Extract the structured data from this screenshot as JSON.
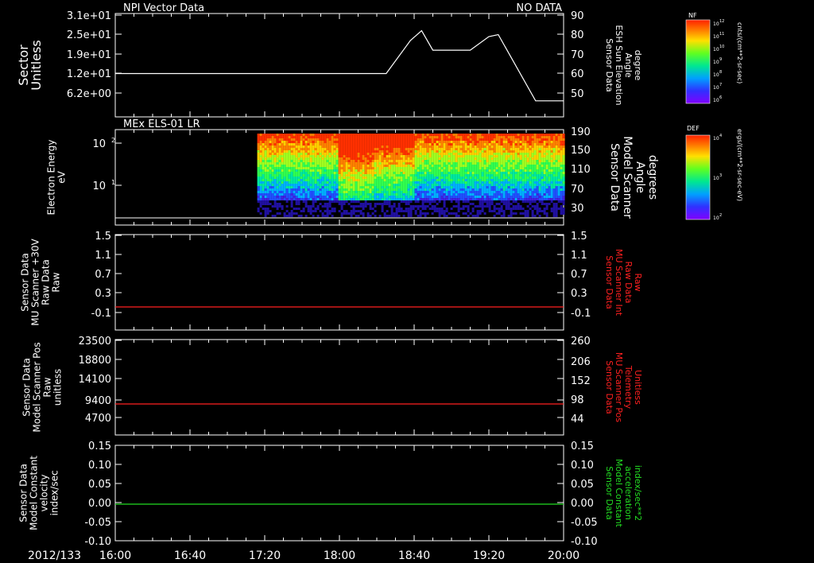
{
  "date_label": "2012/133",
  "time_ticks": [
    "16:00",
    "16:40",
    "17:20",
    "18:00",
    "18:40",
    "19:20",
    "20:00"
  ],
  "panels": [
    {
      "id": "p1",
      "title": "NPI Vector Data",
      "status": "NO DATA",
      "left_label": [
        "Sector",
        "Unitless"
      ],
      "left_ticks": [
        "3.1e+01",
        "2.5e+01",
        "1.9e+01",
        "1.2e+01",
        "6.2e+00"
      ],
      "right_label": [
        "Sensor Data",
        "ESH Sun Elevation",
        "Angle",
        "degree"
      ],
      "right_ticks": [
        "90",
        "80",
        "70",
        "60",
        "50"
      ],
      "right_color": "#ffffff"
    },
    {
      "id": "p2",
      "title": "MEx ELS-01 LR",
      "left_label": [
        "Electron Energy",
        "eV"
      ],
      "left_ticks": [
        "10",
        "10"
      ],
      "left_tick_exps": [
        "2",
        "1"
      ],
      "right_label": [
        "Sensor Data",
        "Model Scanner",
        "Angle",
        "degrees"
      ],
      "right_ticks": [
        "190",
        "150",
        "110",
        "70",
        "30"
      ],
      "right_color": "#ffffff"
    },
    {
      "id": "p3",
      "left_label": [
        "Sensor Data",
        "MU Scanner +30V",
        "Raw Data",
        "Raw"
      ],
      "left_ticks": [
        "1.5",
        "1.1",
        "0.7",
        "0.3",
        "-0.1"
      ],
      "right_label": [
        "Sensor Data",
        "MU Scanner Int",
        "Raw Data",
        "Raw"
      ],
      "right_ticks": [
        "1.5",
        "1.1",
        "0.7",
        "0.3",
        "-0.1"
      ],
      "right_color": "#ff2020"
    },
    {
      "id": "p4",
      "left_label": [
        "Sensor Data",
        "Model Scanner Pos",
        "Raw",
        "unitless"
      ],
      "left_ticks": [
        "23500",
        "18800",
        "14100",
        "9400",
        "4700"
      ],
      "right_label": [
        "Sensor Data",
        "MU Scanner Pos",
        "Telemetry",
        "Unitless"
      ],
      "right_ticks": [
        "260",
        "206",
        "152",
        "98",
        "44"
      ],
      "right_color": "#ff2020"
    },
    {
      "id": "p5",
      "left_label": [
        "Sensor Data",
        "Model Constant",
        "velocity",
        "index/sec"
      ],
      "left_ticks": [
        "0.15",
        "0.10",
        "0.05",
        "0.00",
        "-0.05",
        "-0.10"
      ],
      "right_label": [
        "Sensor Data",
        "Model Constant",
        "acceleration",
        "index/sec**2"
      ],
      "right_ticks": [
        "0.15",
        "0.10",
        "0.05",
        "0.00",
        "-0.05",
        "-0.10"
      ],
      "right_color": "#22dd22"
    }
  ],
  "colorbars": [
    {
      "title": "NF",
      "units": "cnts/(cm**2-sr-sec)",
      "ticks_base": "10",
      "ticks_exp": [
        "12",
        "11",
        "10",
        "9",
        "8",
        "7",
        "6"
      ]
    },
    {
      "title": "DEF",
      "units": "ergs/(cm**2-sr-sec-eV)",
      "ticks_base": "10",
      "ticks_exp": [
        "4",
        "3",
        "2"
      ]
    }
  ],
  "colors": {
    "axis": "#ffffff",
    "red_line": "#ff2020",
    "green_line": "#22dd22"
  },
  "chart_data": [
    {
      "type": "line",
      "title": "NPI Vector Data",
      "series": [
        {
          "name": "ESH Sun Elevation Angle",
          "x": [
            "16:00",
            "18:25",
            "18:38",
            "18:44",
            "18:50",
            "19:10",
            "19:20",
            "19:25",
            "19:45",
            "20:00"
          ],
          "y": [
            60,
            60,
            77,
            82,
            72,
            72,
            79,
            80,
            46,
            46
          ]
        }
      ],
      "ylim_right": [
        43,
        90
      ]
    },
    {
      "type": "heatmap",
      "title": "MEx ELS-01 LR",
      "x_range": [
        "17:16",
        "20:00"
      ],
      "ylabel": "Electron Energy eV"
    },
    {
      "type": "line",
      "series": [
        {
          "name": "MU Scanner +30V",
          "x": [
            "16:00",
            "20:00"
          ],
          "y": [
            0.1,
            0.1
          ]
        }
      ],
      "ylim": [
        -0.3,
        1.5
      ]
    },
    {
      "type": "line",
      "series": [
        {
          "name": "MU Scanner Pos",
          "x": [
            "16:00",
            "20:00"
          ],
          "y": [
            7600,
            7600
          ]
        }
      ],
      "ylim": [
        0,
        23500
      ]
    },
    {
      "type": "line",
      "series": [
        {
          "name": "Model Constant velocity",
          "x": [
            "16:00",
            "20:00"
          ],
          "y": [
            0.0,
            0.0
          ]
        }
      ],
      "ylim": [
        -0.1,
        0.15
      ]
    }
  ]
}
